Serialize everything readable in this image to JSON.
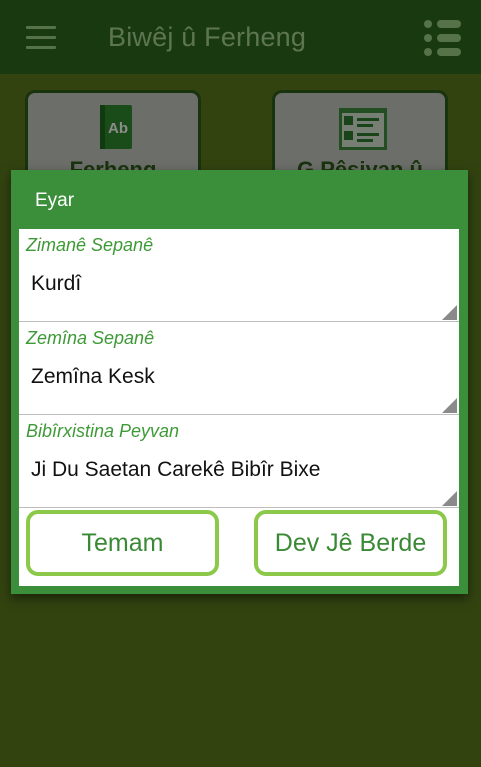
{
  "appbar": {
    "title": "Biwêj û Ferheng",
    "menu_icon": "hamburger-menu-icon",
    "list_icon": "list-icon"
  },
  "tiles": [
    {
      "label": "Ferheng",
      "icon": "dictionary-book-icon"
    },
    {
      "label": "G Pêsiyan û",
      "icon": "translate-document-icon"
    }
  ],
  "dialog": {
    "title": "Eyar",
    "fields": [
      {
        "label": "Zimanê Sepanê",
        "value": "Kurdî"
      },
      {
        "label": "Zemîna Sepanê",
        "value": "Zemîna Kesk"
      },
      {
        "label": "Bibîrxistina Peyvan",
        "value": "Ji Du Saetan Carekê Bibîr Bixe"
      }
    ],
    "ok_label": "Temam",
    "cancel_label": "Dev Jê Berde"
  },
  "colors": {
    "appbar": "#2f6b1e",
    "dialog_header": "#3b8f3b",
    "accent_text": "#3e9a36",
    "button_border": "#8cc94a"
  }
}
